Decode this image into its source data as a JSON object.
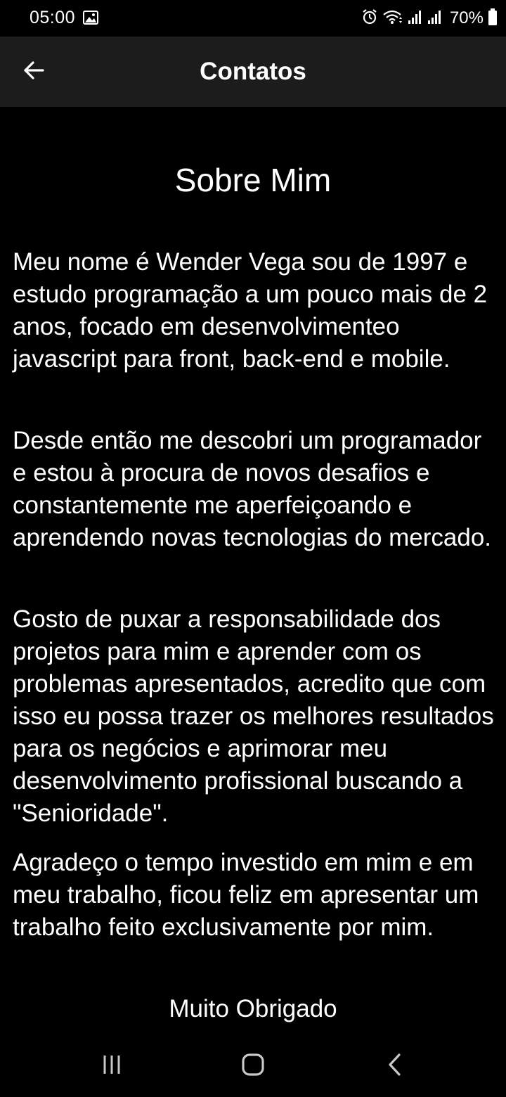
{
  "status_bar": {
    "time": "05:00",
    "battery": "70%",
    "icons": [
      "image-icon",
      "alarm-icon",
      "wifi-icon",
      "signal-icon",
      "signal-icon",
      "battery-icon"
    ]
  },
  "app_bar": {
    "title": "Contatos",
    "back_icon": "arrow-left-icon"
  },
  "content": {
    "heading": "Sobre Mim",
    "paragraphs": [
      "Meu nome é Wender Vega sou de 1997 e estudo programação a um pouco mais de 2 anos, focado em desenvolvimenteo javascript para front, back-end e mobile.",
      "Desde então me descobri um programador e estou à procura de novos desafios e constantemente me aperfeiçoando e aprendendo novas tecnologias do mercado.",
      "Gosto de puxar a responsabilidade dos projetos para mim e aprender com os problemas apresentados, acredito que com isso eu possa trazer os melhores resultados para os negócios e aprimorar meu desenvolvimento profissional buscando a \"Senioridade\".",
      "Agradeço o tempo investido em mim e em meu trabalho, ficou feliz em apresentar um trabalho feito exclusivamente por mim."
    ],
    "closing": "Muito Obrigado"
  },
  "nav_bar": {
    "icons": [
      "recents-icon",
      "home-icon",
      "back-icon"
    ]
  },
  "colors": {
    "background": "#000000",
    "app_bar": "#1c1c1c",
    "text": "#ffffff"
  }
}
